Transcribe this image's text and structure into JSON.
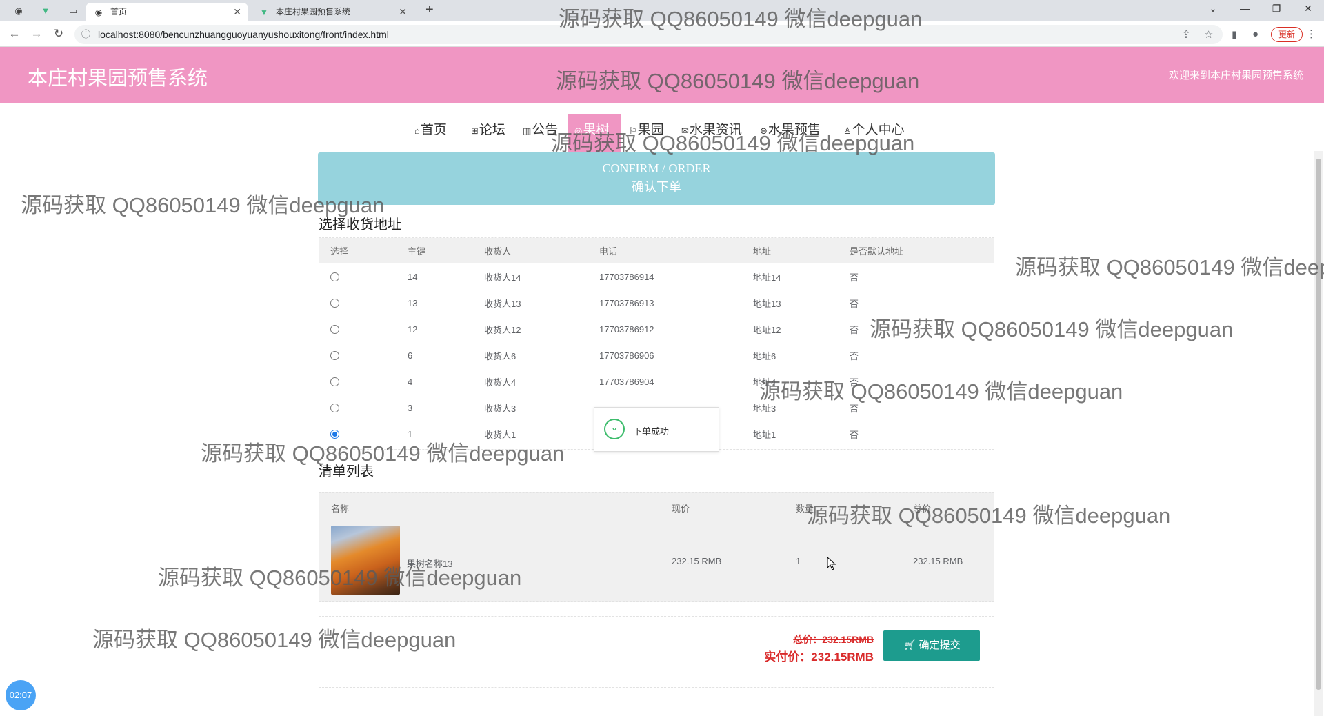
{
  "browser": {
    "tabs": [
      {
        "label": "首页",
        "icon": "globe-icon"
      },
      {
        "label": "本庄村果园预售系统",
        "icon": "vue-icon"
      }
    ],
    "url": "localhost:8080/bencunzhuangguoyuanyushouxitong/front/index.html",
    "update_label": "更新"
  },
  "header": {
    "title": "本庄村果园预售系统",
    "welcome": "欢迎来到本庄村果园预售系统"
  },
  "nav": {
    "items": [
      {
        "label": "首页",
        "icon": "⌂"
      },
      {
        "label": "论坛",
        "icon": "⊞"
      },
      {
        "label": "公告",
        "icon": "▥"
      },
      {
        "label": "果树",
        "icon": "◎"
      },
      {
        "label": "果园",
        "icon": "⚐"
      },
      {
        "label": "水果资讯",
        "icon": "✉"
      },
      {
        "label": "水果预售",
        "icon": "⊖"
      },
      {
        "label": "个人中心",
        "icon": "♙"
      }
    ]
  },
  "banner": {
    "en": "CONFIRM / ORDER",
    "zh": "确认下单"
  },
  "address_section": {
    "title": "选择收货地址",
    "columns": [
      "选择",
      "主键",
      "收货人",
      "电话",
      "地址",
      "是否默认地址"
    ],
    "rows": [
      {
        "id": "14",
        "name": "收货人14",
        "phone": "17703786914",
        "address": "地址14",
        "default": "否",
        "checked": false
      },
      {
        "id": "13",
        "name": "收货人13",
        "phone": "17703786913",
        "address": "地址13",
        "default": "否",
        "checked": false
      },
      {
        "id": "12",
        "name": "收货人12",
        "phone": "17703786912",
        "address": "地址12",
        "default": "否",
        "checked": false
      },
      {
        "id": "6",
        "name": "收货人6",
        "phone": "17703786906",
        "address": "地址6",
        "default": "否",
        "checked": false
      },
      {
        "id": "4",
        "name": "收货人4",
        "phone": "17703786904",
        "address": "地址4",
        "default": "否",
        "checked": false
      },
      {
        "id": "3",
        "name": "收货人3",
        "phone": "",
        "address": "地址3",
        "default": "否",
        "checked": false
      },
      {
        "id": "1",
        "name": "收货人1",
        "phone": "",
        "address": "地址1",
        "default": "否",
        "checked": true
      }
    ]
  },
  "toast": {
    "message": "下单成功"
  },
  "cart_section": {
    "title": "清单列表",
    "columns": [
      "名称",
      "现价",
      "数量",
      "总价"
    ],
    "items": [
      {
        "name": "果树名称13",
        "price": "232.15 RMB",
        "qty": "1",
        "total": "232.15 RMB"
      }
    ]
  },
  "totals": {
    "original": "总价：232.15RMB",
    "actual": "实付价：232.15RMB",
    "submit_label": "确定提交"
  },
  "recorder": {
    "time": "02:07"
  },
  "watermark": "源码获取 QQ86050149 微信deepguan",
  "colors": {
    "header": "#f096c3",
    "banner": "#96d3dd",
    "submit": "#1d9c8e",
    "price": "#d92b2b"
  }
}
